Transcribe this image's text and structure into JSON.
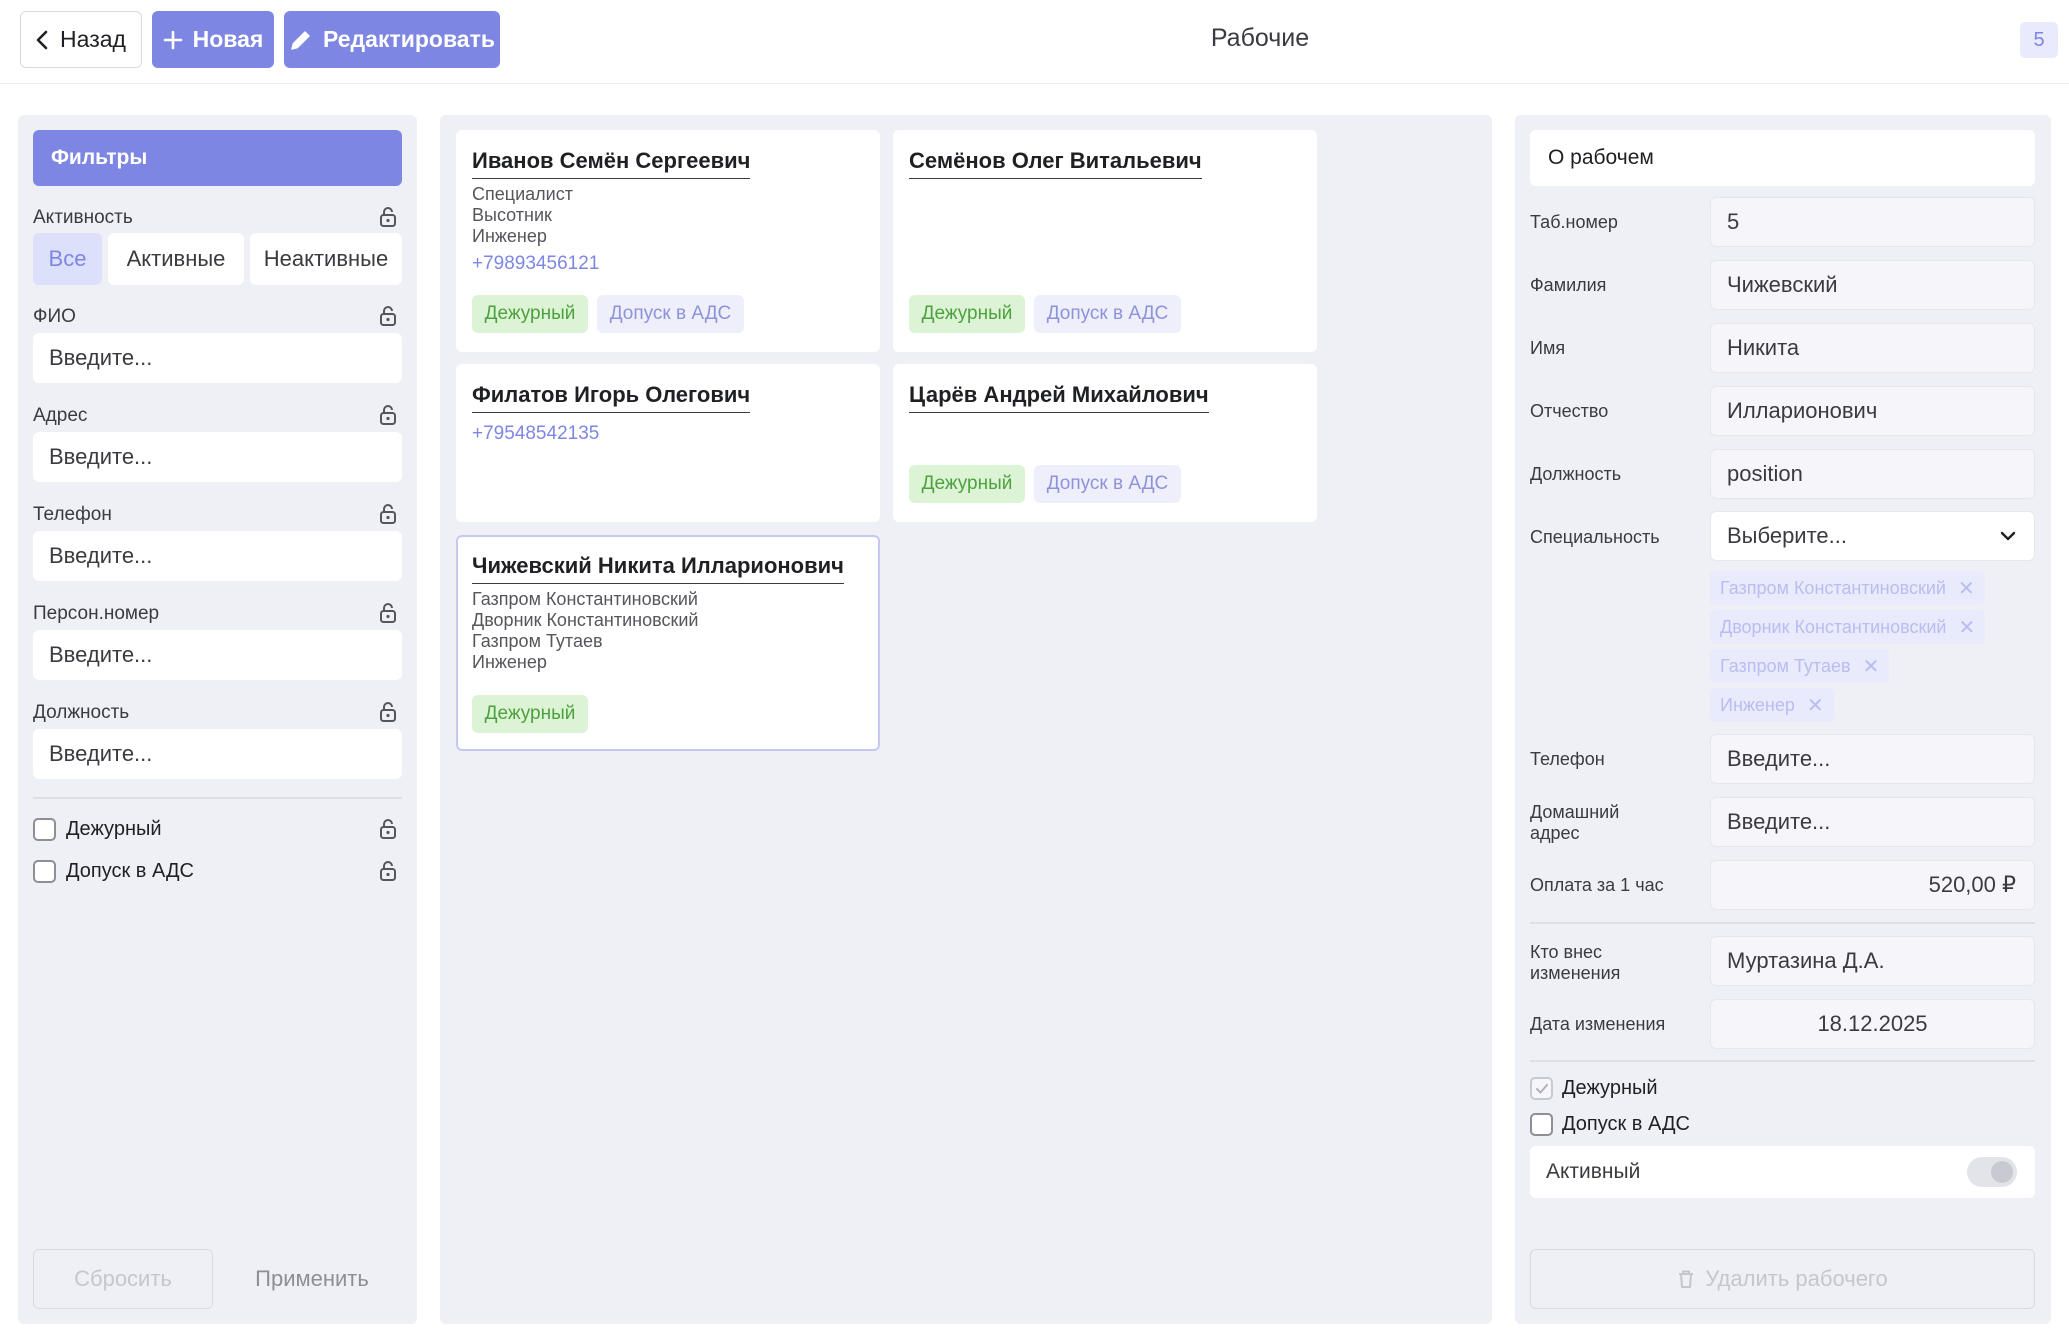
{
  "header": {
    "back_label": "Назад",
    "new_label": "Новая",
    "edit_label": "Редактировать",
    "title": "Рабочие",
    "count": "5"
  },
  "filters": {
    "title": "Фильтры",
    "activity_label": "Активность",
    "activity_options": [
      "Все",
      "Активные",
      "Неактивные"
    ],
    "activity_selected": "Все",
    "fio_label": "ФИО",
    "address_label": "Адрес",
    "phone_label": "Телефон",
    "person_number_label": "Персон.номер",
    "position_label": "Должность",
    "placeholder": "Введите...",
    "duty_label": "Дежурный",
    "ads_label": "Допуск в АДС",
    "reset_label": "Сбросить",
    "apply_label": "Применить"
  },
  "tags": {
    "duty": "Дежурный",
    "ads": "Допуск в АДС"
  },
  "cards": [
    {
      "name": "Иванов Семён Сергеевич",
      "lines": [
        "Специалист",
        "Высотник",
        "Инженер"
      ],
      "phone": "+79893456121"
    },
    {
      "name": "Семёнов Олег Витальевич"
    },
    {
      "name": "Филатов Игорь Олегович",
      "phone": "+79548542135"
    },
    {
      "name": "Царёв Андрей Михайлович"
    },
    {
      "name": "Чижевский Никита Илларионович",
      "lines": [
        "Газпром Константиновский",
        "Дворник Константиновский",
        "Газпром Тутаев",
        "Инженер"
      ]
    }
  ],
  "details": {
    "title": "О рабочем",
    "tab_number_label": "Таб.номер",
    "tab_number": "5",
    "last_name_label": "Фамилия",
    "last_name": "Чижевский",
    "first_name_label": "Имя",
    "first_name": "Никита",
    "patronymic_label": "Отчество",
    "patronymic": "Илларионович",
    "position_label": "Должность",
    "position": "position",
    "specialty_label": "Специальность",
    "specialty_placeholder": "Выберите...",
    "specialties": [
      "Газпром Константиновский",
      "Дворник Константиновский",
      "Газпром Тутаев",
      "Инженер"
    ],
    "phone_label": "Телефон",
    "phone_placeholder": "Введите...",
    "home_address_label_1": "Домашний",
    "home_address_label_2": "адрес",
    "home_address_placeholder": "Введите...",
    "rate_label": "Оплата за 1 час",
    "rate": "520,00 ₽",
    "changed_by_label_1": "Кто внес",
    "changed_by_label_2": "изменения",
    "changed_by": "Муртазина Д.А.",
    "change_date_label": "Дата изменения",
    "change_date": "18.12.2025",
    "duty_label": "Дежурный",
    "duty_checked": true,
    "ads_label": "Допуск в АДС",
    "ads_checked": false,
    "active_label": "Активный",
    "delete_label": "Удалить рабочего"
  }
}
